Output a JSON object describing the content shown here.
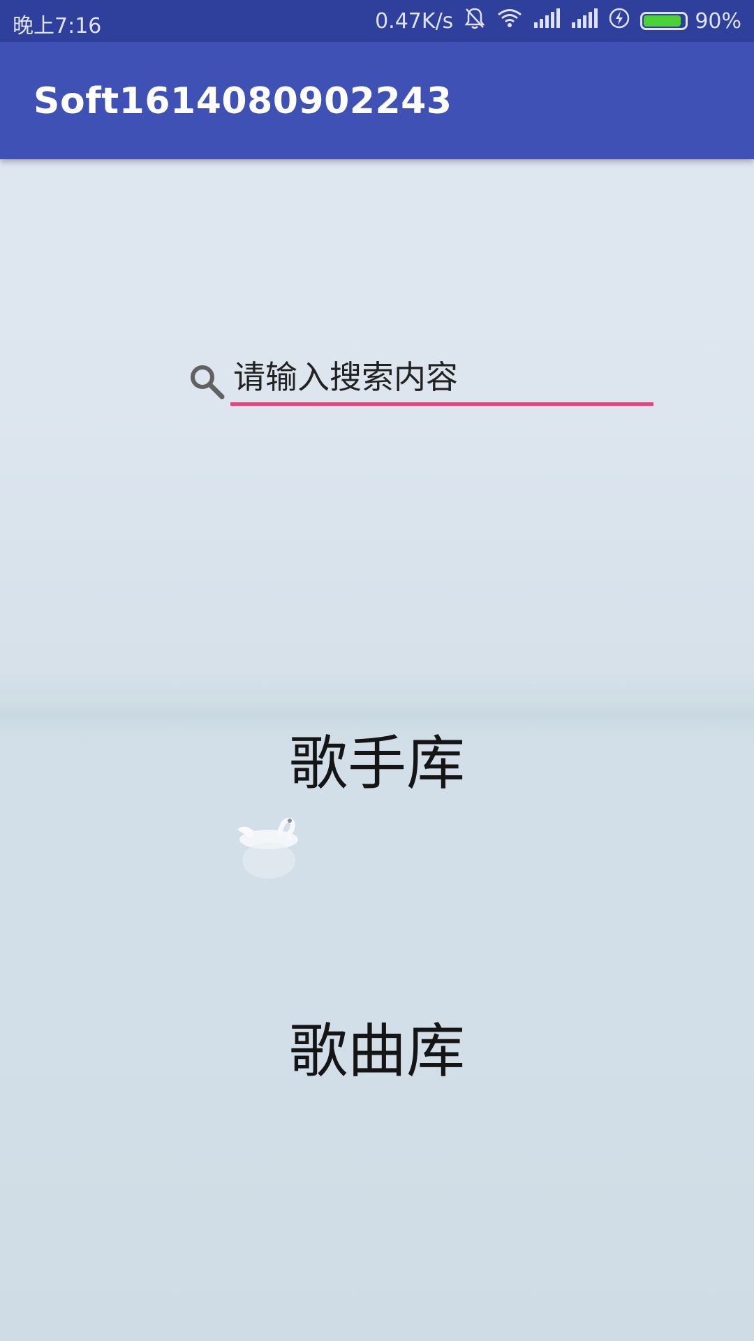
{
  "status_bar": {
    "time": "晚上7:16",
    "net_speed": "0.47K/s",
    "battery_percent": "90%",
    "battery_level": 0.9,
    "battery_color": "#4cd236",
    "icons": [
      "bell-off-icon",
      "wifi-icon",
      "signal-icon",
      "signal-icon",
      "charging-icon",
      "battery-icon"
    ]
  },
  "app_bar": {
    "title": "Soft1614080902243",
    "color": "#3f51b5"
  },
  "search": {
    "placeholder": "请输入搜索内容",
    "value": "",
    "icon": "search-icon",
    "underline_color": "#e0477b"
  },
  "main": {
    "singer_library_label": "歌手库",
    "song_library_label": "歌曲库"
  }
}
